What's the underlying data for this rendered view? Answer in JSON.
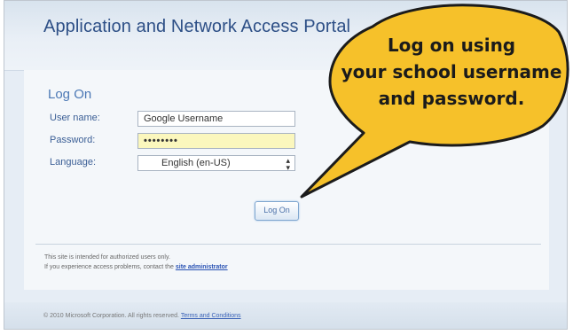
{
  "portal": {
    "title": "Application and Network Access Portal"
  },
  "form": {
    "heading": "Log On",
    "username_label": "User name:",
    "username_value": "Google Username",
    "password_label": "Password:",
    "password_value": "••••••••",
    "language_label": "Language:",
    "language_value": "English (en-US)",
    "submit_label": "Log On"
  },
  "notice": {
    "line1": "This site is intended for authorized users only.",
    "line2": "If you experience access problems, contact the",
    "link": "site administrator"
  },
  "footer": {
    "text": "© 2010 Microsoft Corporation. All rights reserved.",
    "link": "Terms and Conditions"
  },
  "callout": {
    "line1": "Log on using",
    "line2": "your school username",
    "line3": "and password.",
    "fill_color": "#f6c12a"
  }
}
